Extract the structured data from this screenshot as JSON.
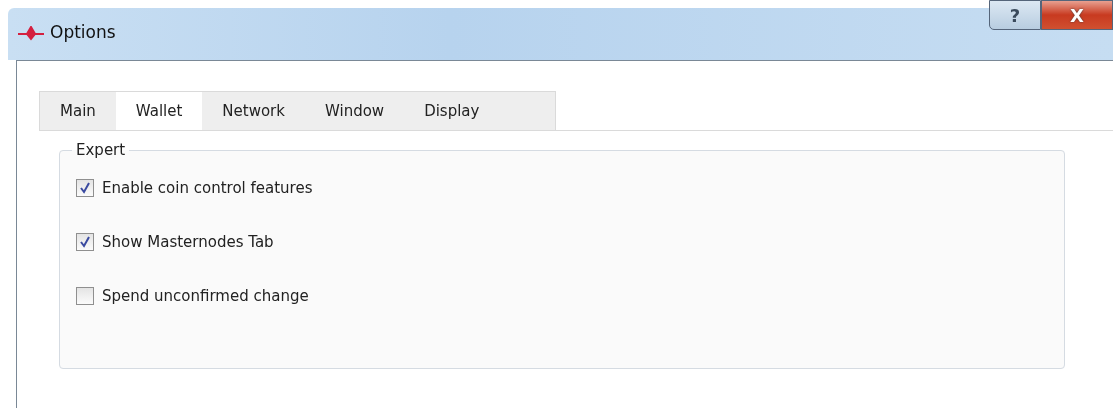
{
  "window": {
    "title": "Options",
    "help_button": "?",
    "close_button": "X"
  },
  "tabs": [
    {
      "label": "Main",
      "selected": false
    },
    {
      "label": "Wallet",
      "selected": true
    },
    {
      "label": "Network",
      "selected": false
    },
    {
      "label": "Window",
      "selected": false
    },
    {
      "label": "Display",
      "selected": false
    }
  ],
  "group": {
    "title": "Expert",
    "options": [
      {
        "label": "Enable coin control features",
        "checked": true
      },
      {
        "label": "Show Masternodes Tab",
        "checked": true
      },
      {
        "label": "Spend unconfirmed change",
        "checked": false
      }
    ]
  }
}
